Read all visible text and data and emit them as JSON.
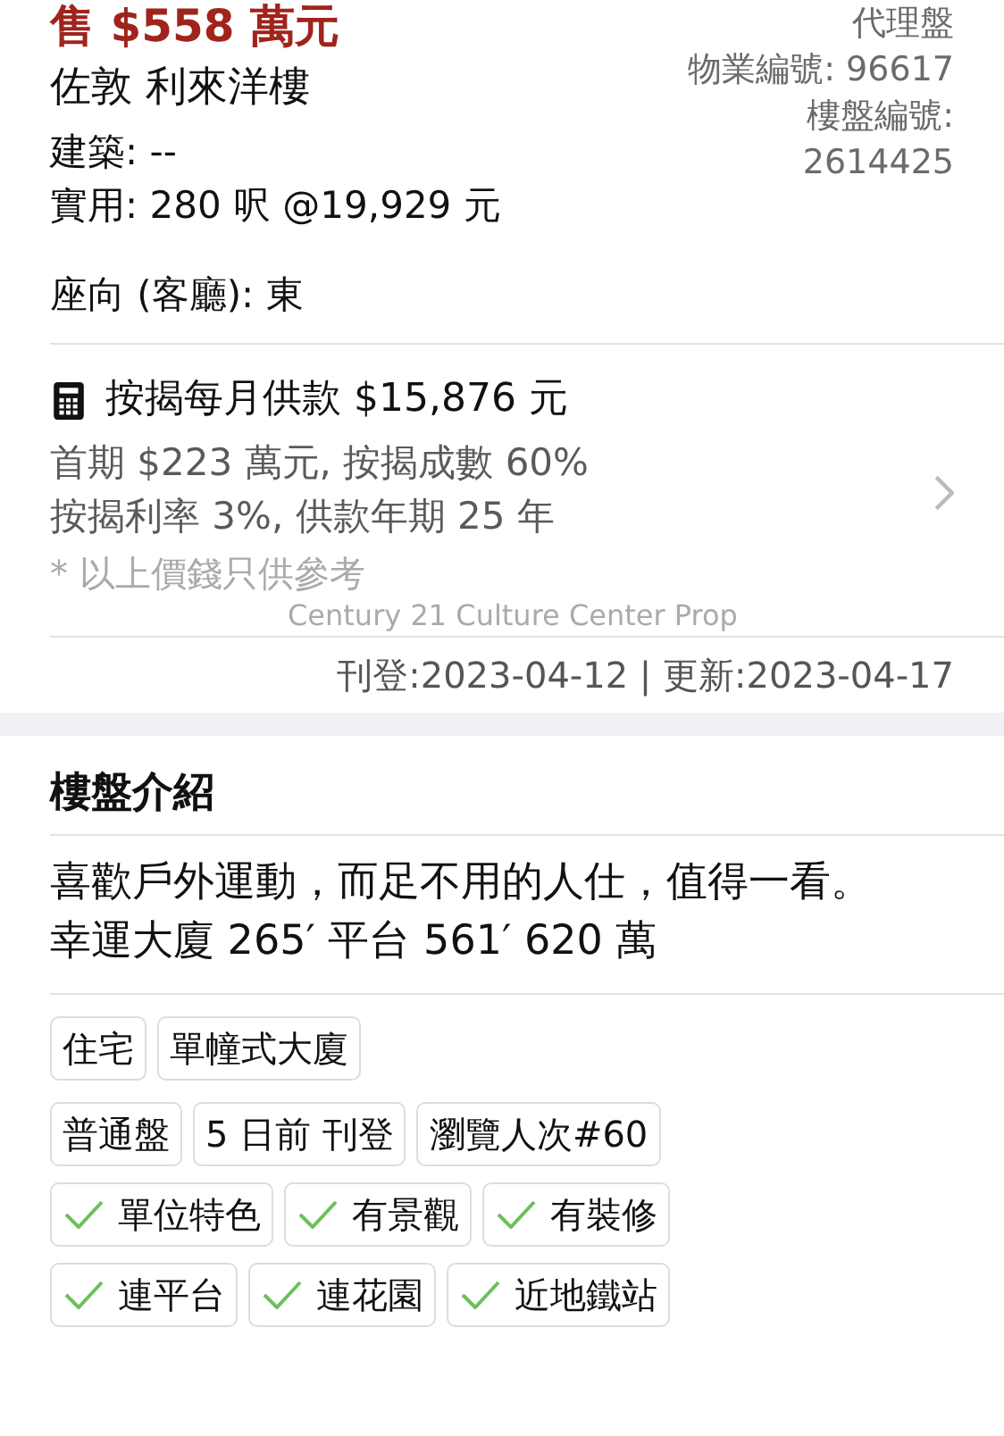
{
  "header": {
    "price": "售 $558 萬元",
    "title": "佐敦 利來洋樓",
    "listing_type": "代理盤",
    "property_no": "物業編號: 96617",
    "listing_no_label": "樓盤編號:",
    "listing_no": "2614425"
  },
  "details": [
    "建築: --",
    "實用: 280 呎  @19,929 元"
  ],
  "facing": "座向 (客廳): 東",
  "mortgage": {
    "title": "按揭每月供款 $15,876 元",
    "lines": [
      "首期 $223 萬元, 按揭成數 60%",
      "按揭利率 3%, 供款年期 25 年"
    ],
    "note": "* 以上價錢只供參考"
  },
  "agency": "Century 21 Culture Center Prop",
  "dates": "刊登:2023-04-12 | 更新:2023-04-17",
  "intro": {
    "heading": "樓盤介紹",
    "lines": [
      "喜歡戶外運動，而足不用的人仕，值得一看。",
      "幸運大廈 265′ 平台 561′ 620 萬"
    ]
  },
  "tag_rows": [
    [
      {
        "label": "住宅",
        "kind": "plain"
      },
      {
        "label": "單幢式大廈",
        "kind": "plain"
      }
    ],
    [
      {
        "label": "普通盤",
        "kind": "plain"
      },
      {
        "label": "5 日前 刊登",
        "kind": "plain"
      },
      {
        "label": "瀏覽人次#60",
        "kind": "plain"
      }
    ],
    [
      {
        "label": "單位特色",
        "kind": "check"
      },
      {
        "label": "有景觀",
        "kind": "check"
      },
      {
        "label": "有裝修",
        "kind": "check"
      }
    ],
    [
      {
        "label": "連平台",
        "kind": "check"
      },
      {
        "label": "連花園",
        "kind": "check"
      },
      {
        "label": "近地鐵站",
        "kind": "check"
      }
    ]
  ]
}
